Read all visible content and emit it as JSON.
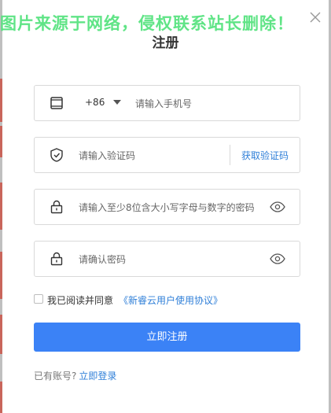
{
  "watermark": "图片来源于网络，侵权联系站长删除！",
  "title": "注册",
  "phone": {
    "country_code": "+86",
    "placeholder": "请输入手机号"
  },
  "verify": {
    "placeholder": "请输入验证码",
    "get_code_label": "获取验证码"
  },
  "password": {
    "placeholder": "请输入至少8位含大小写字母与数字的密码"
  },
  "confirm": {
    "placeholder": "请确认密码"
  },
  "agreement": {
    "text": "我已阅读并同意",
    "link": "《新睿云用户使用协议》"
  },
  "submit_label": "立即注册",
  "login": {
    "prompt": "已有账号?",
    "link": "立即登录"
  },
  "colors": {
    "primary": "#3b82f6",
    "link": "#2f7fd8",
    "watermark": "#4fe27a"
  }
}
